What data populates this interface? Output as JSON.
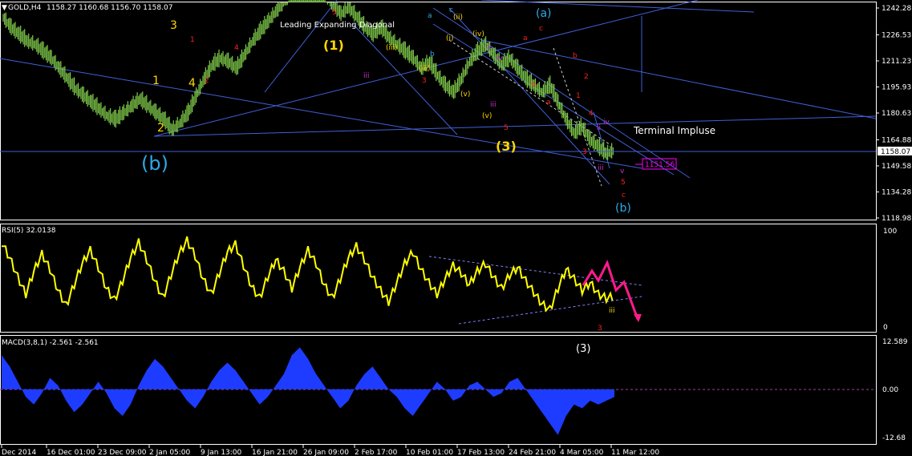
{
  "window": {
    "symbol_label": "GOLD,H4",
    "ohlc": "1158.27 1160.68 1156.70 1158.07",
    "rsi_label": "RSI(5) 32.0138",
    "macd_label": "MACD(3,8,1) -2.561 -2.561"
  },
  "colors": {
    "background": "#000000",
    "candles": "#7fc94a",
    "trendline": "#4060d8",
    "rsi_line": "#ffff00",
    "macd_hist": "#1e3cff",
    "wave_red": "#ff2020",
    "wave_yellow": "#ffd700",
    "wave_magenta": "#d030d0",
    "wave_cyan": "#2ea8e8",
    "forecast_pink": "#ff1a8c",
    "price_box": "#ff00ff"
  },
  "price_axis": {
    "ticks": [
      "1242.28",
      "1226.53",
      "1211.23",
      "1195.93",
      "1180.63",
      "1164.88",
      "1149.58",
      "1134.28",
      "1118.98"
    ],
    "current_price": "1158.07",
    "target_box": "1151.56"
  },
  "rsi_axis": {
    "ticks": [
      "100",
      "0"
    ]
  },
  "macd_axis": {
    "ticks": [
      "12.589",
      "0.00",
      "-12.68"
    ]
  },
  "time_axis": {
    "labels": [
      "Dec 2014",
      "16 Dec 01:00",
      "23 Dec 09:00",
      "2 Jan 05:00",
      "9 Jan 13:00",
      "16 Jan 21:00",
      "26 Jan 09:00",
      "2 Feb 17:00",
      "10 Feb 01:00",
      "17 Feb 13:00",
      "24 Feb 21:00",
      "4 Mar 05:00",
      "11 Mar 12:00"
    ]
  },
  "annotations": {
    "leading_diagonal": "Leading Expanding Diagonal",
    "terminal_impulse": "Terminal Impluse",
    "wave_1": "(1)",
    "wave_3": "(3)",
    "wave_b_big": "(b)",
    "wave_a_top": "(a)",
    "wave_b_bottom": "(b)",
    "rsi_3": "(3)",
    "labels": [
      {
        "t": "3",
        "c": "wave_yellow"
      },
      {
        "t": "1",
        "c": "wave_yellow"
      },
      {
        "t": "4",
        "c": "wave_yellow"
      },
      {
        "t": "2",
        "c": "wave_yellow"
      },
      {
        "t": "1",
        "c": "wave_red"
      },
      {
        "t": "2",
        "c": "wave_red"
      },
      {
        "t": "4",
        "c": "wave_red"
      },
      {
        "t": "5",
        "c": "wave_red"
      },
      {
        "t": "iii",
        "c": "wave_magenta"
      },
      {
        "t": "3",
        "c": "wave_red"
      },
      {
        "t": "5",
        "c": "wave_red"
      },
      {
        "t": "(ii)",
        "c": "wave_yellow"
      },
      {
        "t": "(iv)",
        "c": "wave_yellow"
      },
      {
        "t": "(i)",
        "c": "wave_yellow"
      },
      {
        "t": "(iii)",
        "c": "wave_yellow"
      },
      {
        "t": "(v)",
        "c": "wave_yellow"
      },
      {
        "t": "(iii)",
        "c": "wave_yellow"
      },
      {
        "t": "(v)",
        "c": "wave_yellow"
      },
      {
        "t": "a",
        "c": "wave_red"
      },
      {
        "t": "c",
        "c": "wave_red"
      },
      {
        "t": "b",
        "c": "wave_red"
      },
      {
        "t": "a",
        "c": "wave_red"
      },
      {
        "t": "b",
        "c": "wave_red"
      },
      {
        "t": "2",
        "c": "wave_red"
      },
      {
        "t": "1",
        "c": "wave_red"
      },
      {
        "t": "4",
        "c": "wave_red"
      },
      {
        "t": "3",
        "c": "wave_red"
      },
      {
        "t": "5",
        "c": "wave_red"
      },
      {
        "t": "c",
        "c": "wave_red"
      },
      {
        "t": "iv",
        "c": "wave_magenta"
      },
      {
        "t": "ii",
        "c": "wave_magenta"
      },
      {
        "t": "iii",
        "c": "wave_magenta"
      },
      {
        "t": "v",
        "c": "wave_magenta"
      },
      {
        "t": "ii",
        "c": "wave_magenta"
      },
      {
        "t": "iv",
        "c": "wave_magenta"
      },
      {
        "t": "iii",
        "c": "wave_magenta"
      },
      {
        "t": "a",
        "c": "wave_cyan"
      },
      {
        "t": "c",
        "c": "wave_cyan"
      },
      {
        "t": "b",
        "c": "wave_cyan"
      },
      {
        "t": "iii",
        "c": "wave_yellow"
      },
      {
        "t": "3",
        "c": "wave_red"
      }
    ]
  },
  "chart_data": {
    "type": "line",
    "symbol": "GOLD",
    "timeframe": "H4",
    "price": {
      "current": 1158.07,
      "ylim": [
        1118.98,
        1242.28
      ],
      "close_path": [
        1236,
        1230,
        1226,
        1222,
        1220,
        1216,
        1212,
        1206,
        1200,
        1194,
        1190,
        1186,
        1182,
        1178,
        1176,
        1180,
        1184,
        1188,
        1184,
        1180,
        1176,
        1170,
        1174,
        1180,
        1190,
        1200,
        1208,
        1212,
        1210,
        1206,
        1214,
        1222,
        1228,
        1234,
        1240,
        1246,
        1252,
        1258,
        1262,
        1258,
        1250,
        1244,
        1238,
        1242,
        1236,
        1230,
        1226,
        1230,
        1224,
        1220,
        1216,
        1212,
        1206,
        1210,
        1202,
        1196,
        1192,
        1200,
        1210,
        1216,
        1220,
        1214,
        1208,
        1212,
        1206,
        1200,
        1196,
        1192,
        1196,
        1186,
        1176,
        1168,
        1172,
        1164,
        1160,
        1156,
        1158
      ]
    },
    "rsi": {
      "period": 5,
      "value": 32.0138,
      "ylim": [
        0,
        100
      ],
      "values": [
        88,
        72,
        52,
        34,
        58,
        76,
        60,
        38,
        22,
        44,
        66,
        80,
        62,
        40,
        28,
        48,
        72,
        88,
        70,
        48,
        30,
        54,
        76,
        90,
        74,
        50,
        34,
        56,
        78,
        86,
        64,
        42,
        30,
        52,
        70,
        58,
        40,
        62,
        80,
        66,
        44,
        30,
        50,
        72,
        84,
        70,
        52,
        38,
        26,
        46,
        66,
        78,
        60,
        46,
        34,
        50,
        64,
        56,
        44,
        58,
        66,
        52,
        40,
        54,
        62,
        48,
        36,
        24,
        18,
        40,
        60,
        50,
        38,
        46,
        34,
        30,
        32
      ]
    },
    "macd": {
      "params": [
        3,
        8,
        1
      ],
      "value": -2.561,
      "signal": -2.561,
      "ylim": [
        -12.68,
        12.589
      ],
      "values": [
        9,
        6,
        2,
        -2,
        -4,
        -1,
        3,
        1,
        -3,
        -6,
        -4,
        -1,
        2,
        -1,
        -5,
        -7,
        -4,
        1,
        5,
        8,
        6,
        3,
        0,
        -3,
        -5,
        -2,
        2,
        5,
        7,
        5,
        2,
        -1,
        -4,
        -2,
        1,
        4,
        9,
        11,
        8,
        4,
        1,
        -2,
        -5,
        -3,
        1,
        4,
        6,
        3,
        0,
        -2,
        -5,
        -7,
        -4,
        -1,
        2,
        0,
        -3,
        -2,
        1,
        2,
        0,
        -2,
        -1,
        2,
        3,
        0,
        -3,
        -6,
        -9,
        -12,
        -7,
        -4,
        -5,
        -3,
        -4,
        -3,
        -2
      ]
    }
  }
}
